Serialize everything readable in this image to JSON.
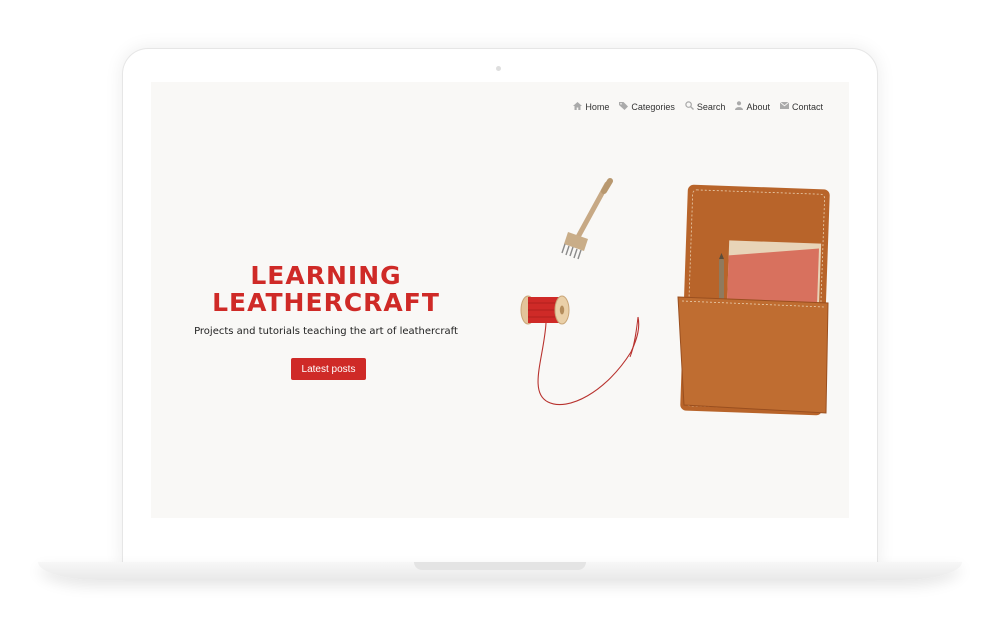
{
  "nav": {
    "items": [
      {
        "label": "Home",
        "icon": "home-icon"
      },
      {
        "label": "Categories",
        "icon": "tag-icon"
      },
      {
        "label": "Search",
        "icon": "search-icon"
      },
      {
        "label": "About",
        "icon": "user-icon"
      },
      {
        "label": "Contact",
        "icon": "envelope-icon"
      }
    ]
  },
  "hero": {
    "title_line1": "LEARNING",
    "title_line2": "LEATHERCRAFT",
    "subtitle": "Projects and tutorials teaching the art of leathercraft",
    "cta_label": "Latest posts"
  },
  "colors": {
    "accent": "#cf2a27",
    "screen_bg": "#f9f8f6",
    "leather": "#b8642a"
  }
}
